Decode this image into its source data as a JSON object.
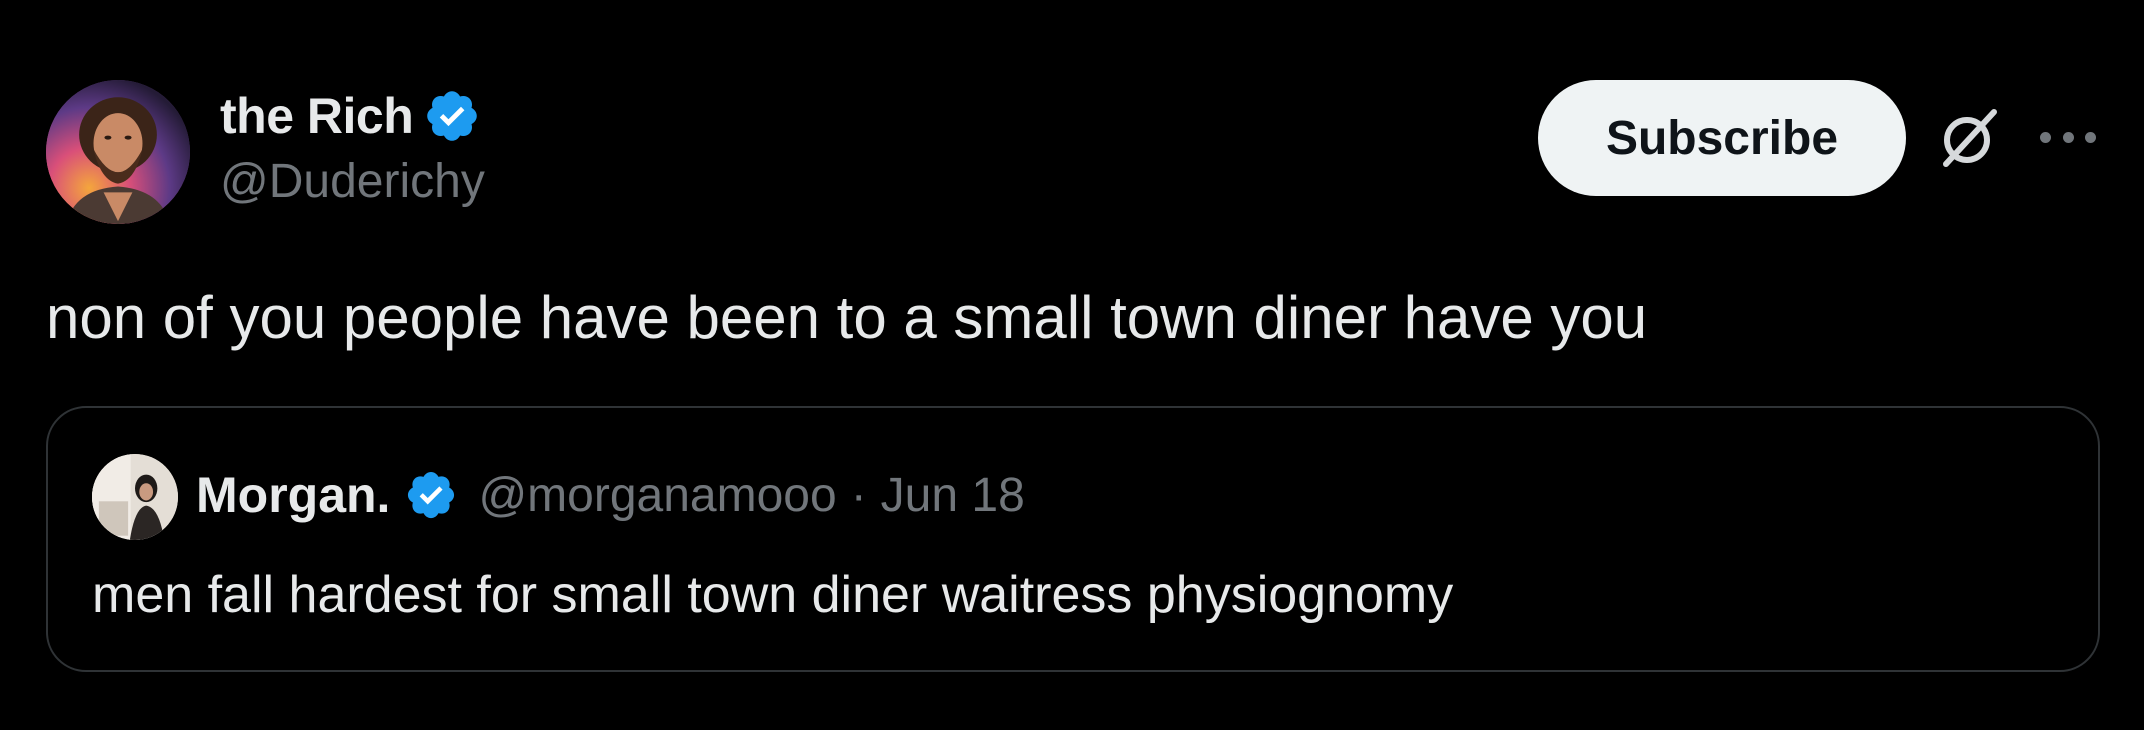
{
  "author": {
    "display_name": "the Rich",
    "handle": "@Duderichy",
    "verified": true
  },
  "actions": {
    "subscribe_label": "Subscribe",
    "grok_icon": "grok-icon",
    "more_icon": "more-icon"
  },
  "tweet": {
    "text": "non of you people have been to a small town diner have you"
  },
  "quoted": {
    "display_name": "Morgan.",
    "handle": "@morganamooo",
    "separator": "·",
    "date": "Jun 18",
    "verified": true,
    "text": "men fall hardest for small town diner waitress physiognomy"
  },
  "colors": {
    "background": "#000000",
    "primary_text": "#e7e9ea",
    "secondary_text": "#71767b",
    "verified_blue": "#1d9bf0",
    "subscribe_bg": "#eff3f4",
    "border": "#2f3336"
  }
}
